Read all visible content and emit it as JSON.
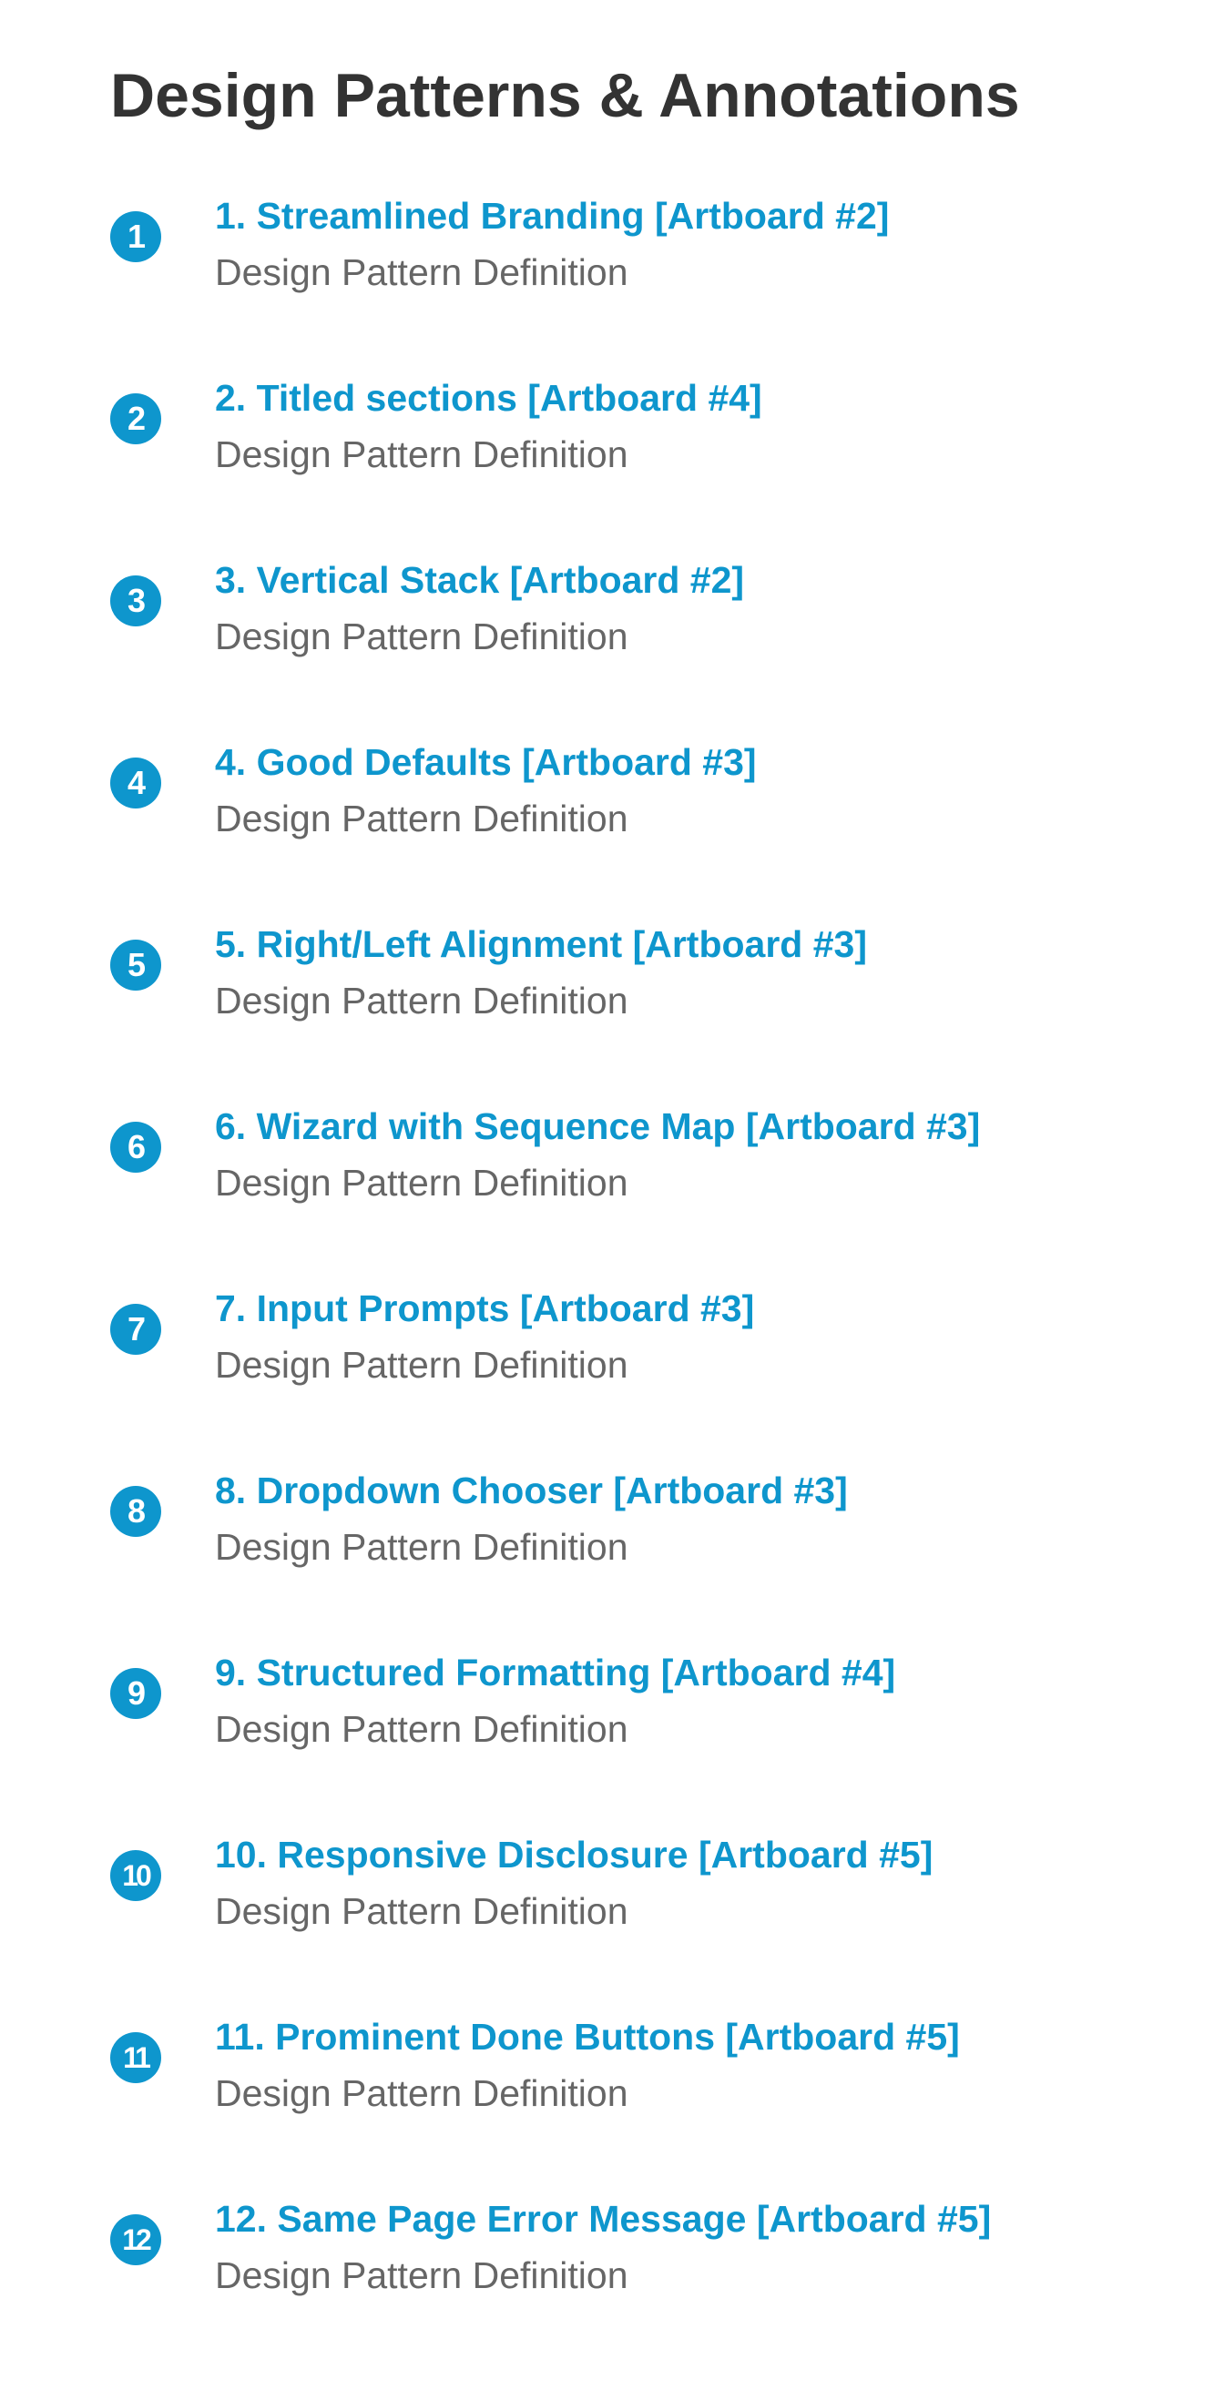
{
  "page": {
    "title": "Design Patterns & Annotations"
  },
  "theme": {
    "accent": "#0e96cd",
    "title_color": "#333333",
    "desc_color": "#666666"
  },
  "patterns": [
    {
      "badge": "1",
      "title": "1. Streamlined Branding [Artboard #2]",
      "desc": "Design Pattern Definition"
    },
    {
      "badge": "2",
      "title": "2. Titled sections [Artboard #4]",
      "desc": "Design Pattern Definition"
    },
    {
      "badge": "3",
      "title": "3. Vertical Stack [Artboard #2]",
      "desc": "Design Pattern Definition"
    },
    {
      "badge": "4",
      "title": "4. Good Defaults [Artboard #3]",
      "desc": "Design Pattern Definition"
    },
    {
      "badge": "5",
      "title": "5. Right/Left Alignment [Artboard #3]",
      "desc": "Design Pattern Definition"
    },
    {
      "badge": "6",
      "title": "6. Wizard with Sequence Map [Artboard #3]",
      "desc": "Design Pattern Definition"
    },
    {
      "badge": "7",
      "title": "7. Input Prompts [Artboard #3]",
      "desc": "Design Pattern Definition"
    },
    {
      "badge": "8",
      "title": "8. Dropdown Chooser [Artboard #3]",
      "desc": "Design Pattern Definition"
    },
    {
      "badge": "9",
      "title": "9. Structured Formatting [Artboard #4]",
      "desc": "Design Pattern Definition"
    },
    {
      "badge": "10",
      "title": "10. Responsive Disclosure [Artboard #5]",
      "desc": "Design Pattern Definition"
    },
    {
      "badge": "11",
      "title": "11. Prominent Done Buttons [Artboard #5]",
      "desc": "Design Pattern Definition"
    },
    {
      "badge": "12",
      "title": "12. Same Page Error Message [Artboard #5]",
      "desc": "Design Pattern Definition"
    }
  ]
}
